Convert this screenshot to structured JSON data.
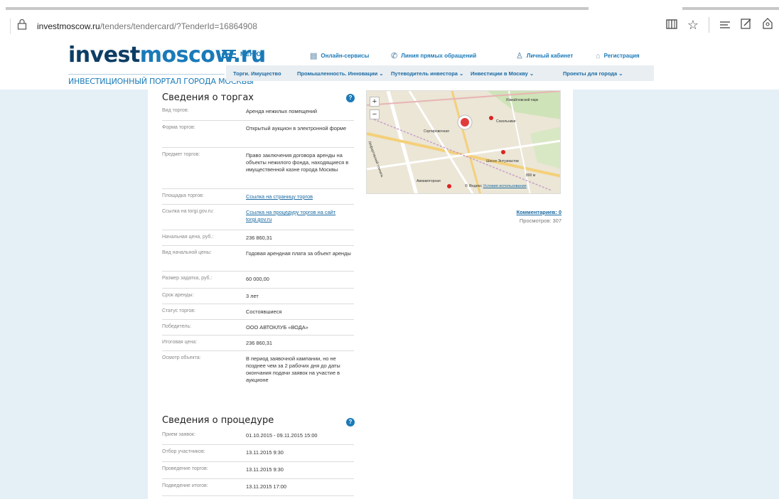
{
  "browser": {
    "url_host": "investmoscow.ru",
    "url_path": "/tenders/tendercard/?TenderId=16864908",
    "icons": [
      "lock-icon",
      "reading-view-icon",
      "favorite-star-icon",
      "hub-icon",
      "web-note-icon",
      "share-icon"
    ]
  },
  "header": {
    "logo_dark": "invest",
    "logo_light": "moscow.ru",
    "tagline": "ИНВЕСТИЦИОННЫЙ ПОРТАЛ ГОРОДА МОСКВЫ",
    "menu_label": "МЕНЮ",
    "top_links": [
      "Онлайн-сервисы",
      "Линия прямых обращений",
      "Личный кабинет",
      "Регистрация"
    ],
    "nav_items": [
      "Торги. Имущество",
      "Промышленность. Инновации ⌄",
      "Путеводитель инвестора ⌄",
      "Инвестиции в Москву ⌄",
      "Проекты для города ⌄"
    ]
  },
  "tender": {
    "title": "Сведения о торгах",
    "rows": [
      {
        "label": "Вид торгов:",
        "value": "Аренда нежилых помещений"
      },
      {
        "label": "Форма торгов:",
        "value": "Открытый аукцион в электронной форме"
      },
      {
        "label": "Предмет торгов:",
        "value": "Право заключения договора аренды на объекты нежилого фонда, находящиеся в имущественной казне города Москвы"
      },
      {
        "label": "Площадка торгов:",
        "value": "Ссылка на страницу торгов"
      },
      {
        "label": "Ссылка на torgi.gov.ru:",
        "value": "Ссылка на процедуру торгов на сайт torgi.gov.ru"
      },
      {
        "label": "Начальная цена, руб.:",
        "value": "236 860,31"
      },
      {
        "label": "Вид начальной цены:",
        "value": "Годовая арендная плата за объект аренды"
      },
      {
        "label": "Размер задатка, руб.:",
        "value": "60 000,00"
      },
      {
        "label": "Срок аренды:",
        "value": "3 лет"
      },
      {
        "label": "Статус торгов:",
        "value": "Состоявшиеся"
      },
      {
        "label": "Победитель:",
        "value": "ООО АВТОКЛУБ «ВОДА»"
      },
      {
        "label": "Итоговая цена:",
        "value": "236 860,31"
      },
      {
        "label": "Осмотр объекта:",
        "value": "В период заявочной кампании, но не позднее чем за 2 рабочих дня до даты окончания подачи заявок на участие в аукционе"
      }
    ]
  },
  "procedure": {
    "title": "Сведения о процедуре",
    "rows": [
      {
        "label": "Прием заявок:",
        "value": "01.10.2015 - 09.11.2015 15:00"
      },
      {
        "label": "Отбор участников:",
        "value": "13.11.2015 9:30"
      },
      {
        "label": "Проведение торгов:",
        "value": "13.11.2015 9:30"
      },
      {
        "label": "Подведение итогов:",
        "value": "13.11.2015 17:00"
      }
    ]
  },
  "map": {
    "zoom_in": "+",
    "zoom_out": "−",
    "copyright": "© Яндекс",
    "terms": "Условия использования",
    "scale": "800 м",
    "labels": [
      "Сокольники",
      "Сортировочная",
      "Шоссе Энтузиастов",
      "Лефортовский тоннель",
      "Авиамоторная",
      "Измайловский парк"
    ]
  },
  "stats": {
    "comments": "Комментариев: 0",
    "views": "Просмотров: 307"
  },
  "colors": {
    "brand_blue": "#1a7ab8",
    "brand_dark": "#0d3d64",
    "side_bg": "#e4eff6"
  }
}
